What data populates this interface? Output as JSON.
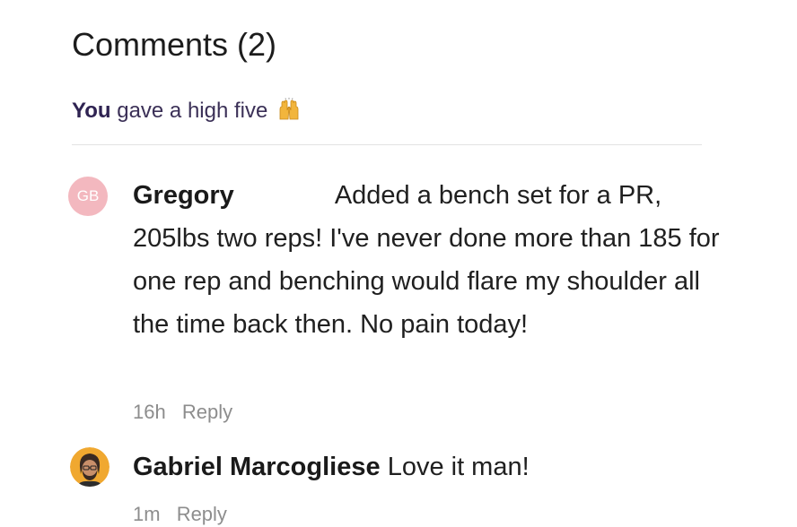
{
  "header": {
    "title": "Comments (2)"
  },
  "high_five": {
    "actor": "You",
    "text": "gave a high five",
    "icon": "raised-hands-icon"
  },
  "comments": [
    {
      "avatar_initials": "GB",
      "avatar_color": "#f3b8bf",
      "author": "Gregory",
      "text": "Added a bench set for a PR, 205lbs two reps! I've never done more than 185 for one rep and benching would flare my shoulder all the time back then. No pain today!",
      "time": "16h",
      "reply_label": "Reply"
    },
    {
      "avatar_icon": "user-photo-avatar",
      "avatar_color": "#f0a830",
      "author": "Gabriel Marcogliese",
      "text": "Love it man!",
      "time": "1m",
      "reply_label": "Reply"
    }
  ],
  "colors": {
    "accent": "#2f2352",
    "meta": "#8d8d8d",
    "divider": "#e3e3e3"
  }
}
